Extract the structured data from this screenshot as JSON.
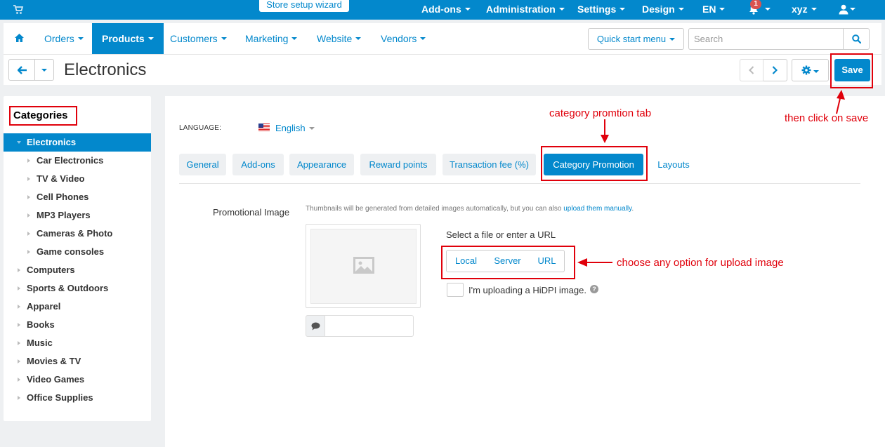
{
  "topbar": {
    "wizard_label": "Store setup wizard",
    "menu": [
      {
        "label": "Add-ons"
      },
      {
        "label": "Administration"
      },
      {
        "label": "Settings"
      },
      {
        "label": "Design"
      },
      {
        "label": "EN"
      }
    ],
    "notification_count": "1",
    "user_label": "xyz",
    "color": "#0388cc"
  },
  "nav": {
    "items": [
      {
        "label": "Orders"
      },
      {
        "label": "Products"
      },
      {
        "label": "Customers"
      },
      {
        "label": "Marketing"
      },
      {
        "label": "Website"
      },
      {
        "label": "Vendors"
      }
    ],
    "active_item": "Products",
    "quick_start_label": "Quick start menu",
    "search_placeholder": "Search"
  },
  "titlebar": {
    "title": "Electronics",
    "save_label": "Save"
  },
  "sidebar": {
    "heading": "Categories",
    "categories": [
      {
        "label": "Electronics"
      },
      {
        "label": "Car Electronics"
      },
      {
        "label": "TV & Video"
      },
      {
        "label": "Cell Phones"
      },
      {
        "label": "MP3 Players"
      },
      {
        "label": "Cameras & Photo"
      },
      {
        "label": "Game consoles"
      },
      {
        "label": "Computers"
      },
      {
        "label": "Sports & Outdoors"
      },
      {
        "label": "Apparel"
      },
      {
        "label": "Books"
      },
      {
        "label": "Music"
      },
      {
        "label": "Movies & TV"
      },
      {
        "label": "Video Games"
      },
      {
        "label": "Office Supplies"
      }
    ],
    "selected": "Electronics"
  },
  "main": {
    "language_label": "LANGUAGE:",
    "language_value": "English",
    "tabs": [
      {
        "label": "General"
      },
      {
        "label": "Add-ons"
      },
      {
        "label": "Appearance"
      },
      {
        "label": "Reward points"
      },
      {
        "label": "Transaction fee (%)"
      },
      {
        "label": "Category Promotion"
      },
      {
        "label": "Layouts"
      }
    ],
    "active_tab": "Category Promotion",
    "promo_label": "Promotional Image",
    "hint_text": "Thumbnails will be generated from detailed images automatically, but you can also ",
    "hint_link": "upload them manually",
    "hint_end": ".",
    "select_file_label": "Select a file or enter a URL",
    "upload_options": [
      {
        "label": "Local"
      },
      {
        "label": "Server"
      },
      {
        "label": "URL"
      }
    ],
    "hidpi_label": "I'm uploading a HiDPI image.",
    "help_glyph": "?"
  },
  "annotations": {
    "tab_note": "category promtion tab",
    "save_note": "then click on save",
    "upload_note": "choose any option for upload image",
    "color": "#e0000b"
  }
}
